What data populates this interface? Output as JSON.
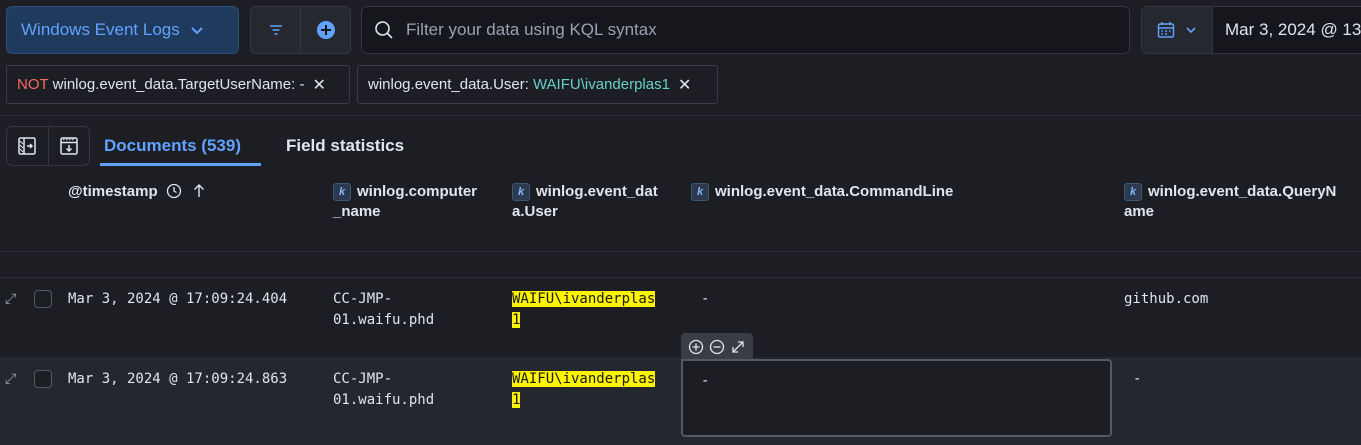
{
  "toolbar": {
    "data_view_label": "Windows Event Logs",
    "kql_placeholder": "Filter your data using KQL syntax",
    "date_value": "Mar 3, 2024 @ 13"
  },
  "filters": [
    {
      "prefix": "NOT",
      "field": "winlog.event_data.TargetUserName: -",
      "value": ""
    },
    {
      "prefix": "",
      "field": "winlog.event_data.User: ",
      "value": "WAIFU\\ivanderplas1"
    }
  ],
  "tabs": {
    "documents": "Documents (539)",
    "field_statistics": "Field statistics"
  },
  "columns": {
    "timestamp": "@timestamp",
    "computer_name_l1": "winlog.computer",
    "computer_name_l2": "_name",
    "user_l1": "winlog.event_dat",
    "user_l2": "a.User",
    "command_line": "winlog.event_data.CommandLine",
    "query_name_l1": "winlog.event_data.QueryN",
    "query_name_l2": "ame",
    "type_badge": "k"
  },
  "rows": [
    {
      "timestamp": "Mar 3, 2024 @ 17:09:24.404",
      "computer_l1": "CC-JMP-",
      "computer_l2": "01.waifu.phd",
      "user_l1": "WAIFU\\ivanderplas",
      "user_l2": "1",
      "command_line": "-",
      "query_name": "github.com"
    },
    {
      "timestamp": "Mar 3, 2024 @ 17:09:24.863",
      "computer_l1": "CC-JMP-",
      "computer_l2": "01.waifu.phd",
      "user_l1": "WAIFU\\ivanderplas",
      "user_l2": "1",
      "command_line": "-",
      "query_name": "-"
    }
  ],
  "colors": {
    "accent": "#61a2ff",
    "not_red": "#f86b63",
    "value_teal": "#66d1c8",
    "highlight": "#fcf300"
  }
}
